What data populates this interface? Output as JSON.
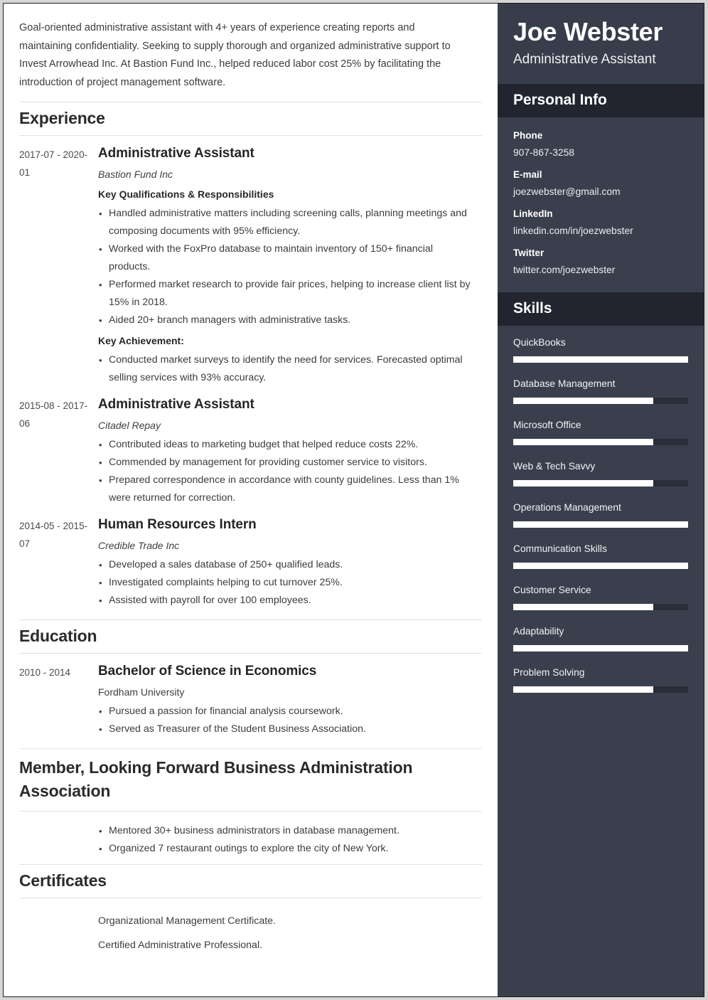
{
  "colors": {
    "sidebar_bg": "#3a3f4d",
    "sidebar_header_bg": "#383d4c",
    "sidebar_section_bg": "#22252f",
    "skill_fill": "#ffffff",
    "skill_track": "#2a2e3a",
    "page_bg": "#ffffff",
    "text": "#3c3c3c"
  },
  "summary": "Goal-oriented administrative assistant with 4+ years of experience creating reports and maintaining confidentiality. Seeking to supply thorough and organized administrative support to Invest Arrowhead Inc. At Bastion Fund Inc., helped reduced labor cost 25% by facilitating the introduction of project management software.",
  "sections": {
    "experience": {
      "heading": "Experience",
      "entries": [
        {
          "dates": "2017-07 - 2020-01",
          "title": "Administrative Assistant",
          "org": "Bastion Fund Inc",
          "subhead": "Key Qualifications & Responsibilities",
          "bullets": [
            "Handled administrative matters including screening calls, planning meetings and composing documents with 95% efficiency.",
            "Worked with the FoxPro database to maintain inventory of 150+ financial products.",
            "Performed market research to provide fair prices, helping to increase client list by 15% in 2018.",
            "Aided 20+ branch managers with administrative tasks."
          ],
          "subhead2": "Key Achievement:",
          "bullets2": [
            "Conducted market surveys to identify the need for services. Forecasted optimal selling services with 93% accuracy."
          ]
        },
        {
          "dates": "2015-08 - 2017-06",
          "title": "Administrative Assistant",
          "org": "Citadel Repay",
          "bullets": [
            "Contributed ideas to marketing budget that helped reduce costs 22%.",
            "Commended by management for providing customer service to visitors.",
            "Prepared correspondence in accordance with county guidelines. Less than 1% were returned for correction."
          ]
        },
        {
          "dates": "2014-05 - 2015-07",
          "title": "Human Resources Intern",
          "org": "Credible Trade Inc",
          "bullets": [
            "Developed a sales database of 250+ qualified leads.",
            "Investigated complaints helping to cut turnover 25%.",
            "Assisted with payroll for over 100 employees."
          ]
        }
      ]
    },
    "education": {
      "heading": "Education",
      "entries": [
        {
          "dates": "2010 - 2014",
          "title": "Bachelor of Science in Economics",
          "org": "Fordham University",
          "bullets": [
            "Pursued a passion for financial analysis coursework.",
            "Served as Treasurer of the Student Business Association."
          ]
        }
      ]
    },
    "membership": {
      "heading": "Member, Looking Forward Business Administration Association",
      "bullets": [
        "Mentored 30+ business administrators in database management.",
        "Organized 7 restaurant outings to explore the city of New York."
      ]
    },
    "certificates": {
      "heading": "Certificates",
      "items": [
        "Organizational Management Certificate.",
        "Certified Administrative Professional."
      ]
    }
  },
  "sidebar": {
    "name": "Joe Webster",
    "role": "Administrative Assistant",
    "personal_info": {
      "heading": "Personal Info",
      "items": [
        {
          "label": "Phone",
          "value": "907-867-3258"
        },
        {
          "label": "E-mail",
          "value": "joezwebster@gmail.com"
        },
        {
          "label": "LinkedIn",
          "value": "linkedin.com/in/joezwebster"
        },
        {
          "label": "Twitter",
          "value": "twitter.com/joezwebster"
        }
      ]
    },
    "skills": {
      "heading": "Skills",
      "items": [
        {
          "label": "QuickBooks",
          "level": 100
        },
        {
          "label": "Database Management",
          "level": 80
        },
        {
          "label": "Microsoft Office",
          "level": 80
        },
        {
          "label": "Web & Tech Savvy",
          "level": 80
        },
        {
          "label": "Operations Management",
          "level": 100
        },
        {
          "label": "Communication Skills",
          "level": 100
        },
        {
          "label": "Customer Service",
          "level": 80
        },
        {
          "label": "Adaptability",
          "level": 100
        },
        {
          "label": "Problem Solving",
          "level": 80
        }
      ]
    }
  }
}
